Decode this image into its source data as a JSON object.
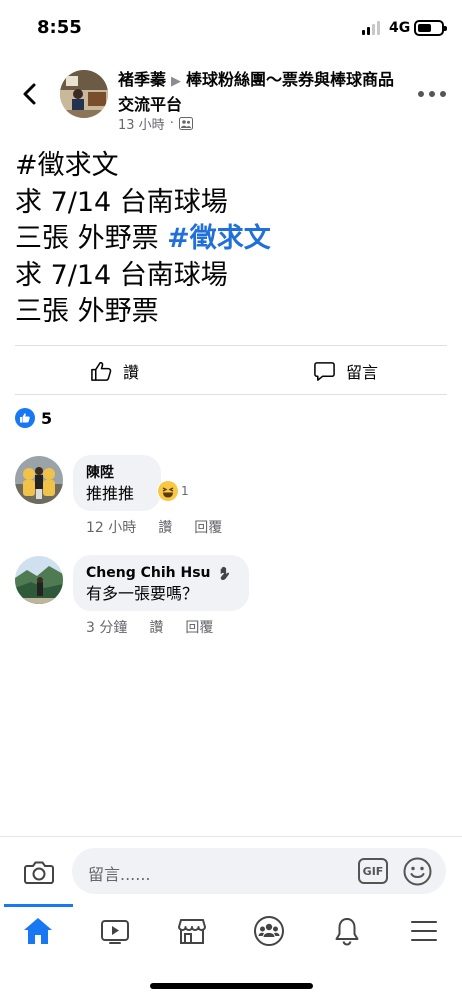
{
  "status_bar": {
    "time": "8:55",
    "network": "4G"
  },
  "post": {
    "author": "褚季蓁",
    "group": "棒球粉絲團～票券與棒球商品交流平台",
    "time": "13 小時",
    "privacy_icon": "group-icon",
    "body_lines": [
      {
        "text": "#徵求文",
        "hashtag": ""
      },
      {
        "text": "求 7/14 台南球場",
        "hashtag": ""
      },
      {
        "text": "三張 外野票 ",
        "hashtag": "#徵求文"
      },
      {
        "text": "求 7/14 台南球場",
        "hashtag": ""
      },
      {
        "text": "三張 外野票",
        "hashtag": ""
      }
    ],
    "like_label": "讚",
    "comment_label": "留言",
    "reaction_count": "5"
  },
  "comments": [
    {
      "name": "陳陞",
      "text": "推推推",
      "time": "12 小時",
      "like_label": "讚",
      "reply_label": "回覆",
      "reaction_count": "1"
    },
    {
      "name": "Cheng Chih Hsu",
      "text": "有多一張要嗎？",
      "time": "3 分鐘",
      "like_label": "讚",
      "reply_label": "回覆"
    }
  ],
  "composer": {
    "placeholder": "留言......",
    "gif_label": "GIF"
  },
  "tabs": [
    "home-icon",
    "video-icon",
    "marketplace-icon",
    "groups-icon",
    "notifications-icon",
    "menu-icon"
  ],
  "colors": {
    "accent": "#1877f2",
    "hashtag": "#216fdb",
    "secondary_text": "#65676b",
    "bubble": "#f0f2f5"
  }
}
